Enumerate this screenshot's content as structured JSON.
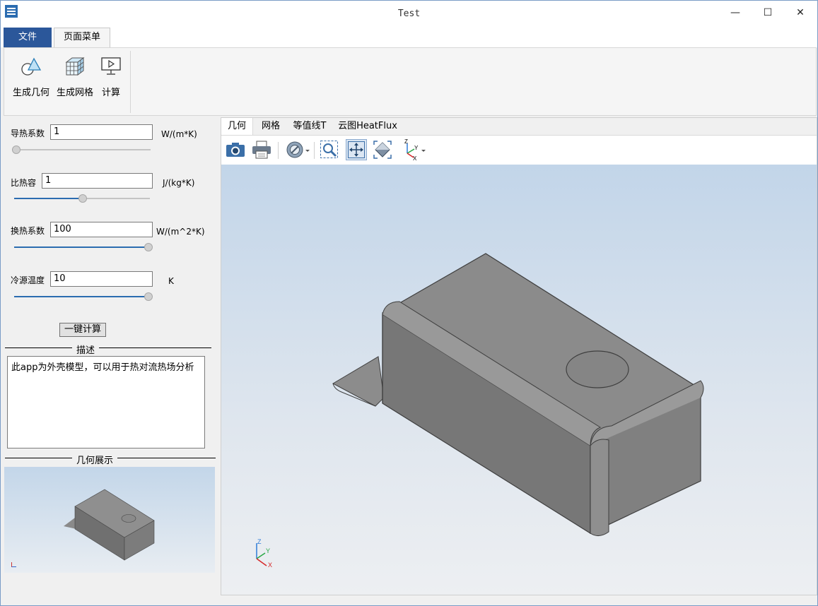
{
  "window": {
    "title": "Test",
    "controls": {
      "minimize": "—",
      "maximize": "☐",
      "close": "✕"
    }
  },
  "ribbon": {
    "tabs": {
      "file": "文件",
      "page_menu": "页面菜单"
    },
    "buttons": {
      "geometry": "生成几何",
      "mesh": "生成网格",
      "compute": "计算"
    }
  },
  "params": {
    "conductivity": {
      "label": "导热系数",
      "value": "1",
      "unit": "W/(m*K)",
      "slider_fraction": 0.0
    },
    "specific_heat": {
      "label": "比热容",
      "value": "1",
      "unit": "J/(kg*K)",
      "slider_fraction": 0.5
    },
    "convection": {
      "label": "换热系数",
      "value": "100",
      "unit": "W/(m^2*K)",
      "slider_fraction": 1.0
    },
    "cold_temp": {
      "label": "冷源温度",
      "value": "10",
      "unit": "K",
      "slider_fraction": 1.0
    }
  },
  "calc_button": "一键计算",
  "description": {
    "title": "描述",
    "text": "此app为外壳模型，可以用于热对流热场分析"
  },
  "geometry_preview": {
    "title": "几何展示"
  },
  "view_tabs": [
    "几何",
    "网格",
    "等值线T",
    "云图HeatFlux"
  ],
  "toolbar": {
    "icons": [
      "camera-icon",
      "print-icon",
      "render-mode-icon",
      "zoom-box-icon",
      "fit-view-icon",
      "reset-view-icon",
      "axes-orientation-icon"
    ],
    "axes_label": "Z Y X"
  },
  "axis_triad": {
    "z": "Z",
    "y": "Y",
    "x": "X"
  },
  "colors": {
    "accent": "#2b579a",
    "slider": "#2b6cb0",
    "model_gray": "#7a7a7a"
  }
}
